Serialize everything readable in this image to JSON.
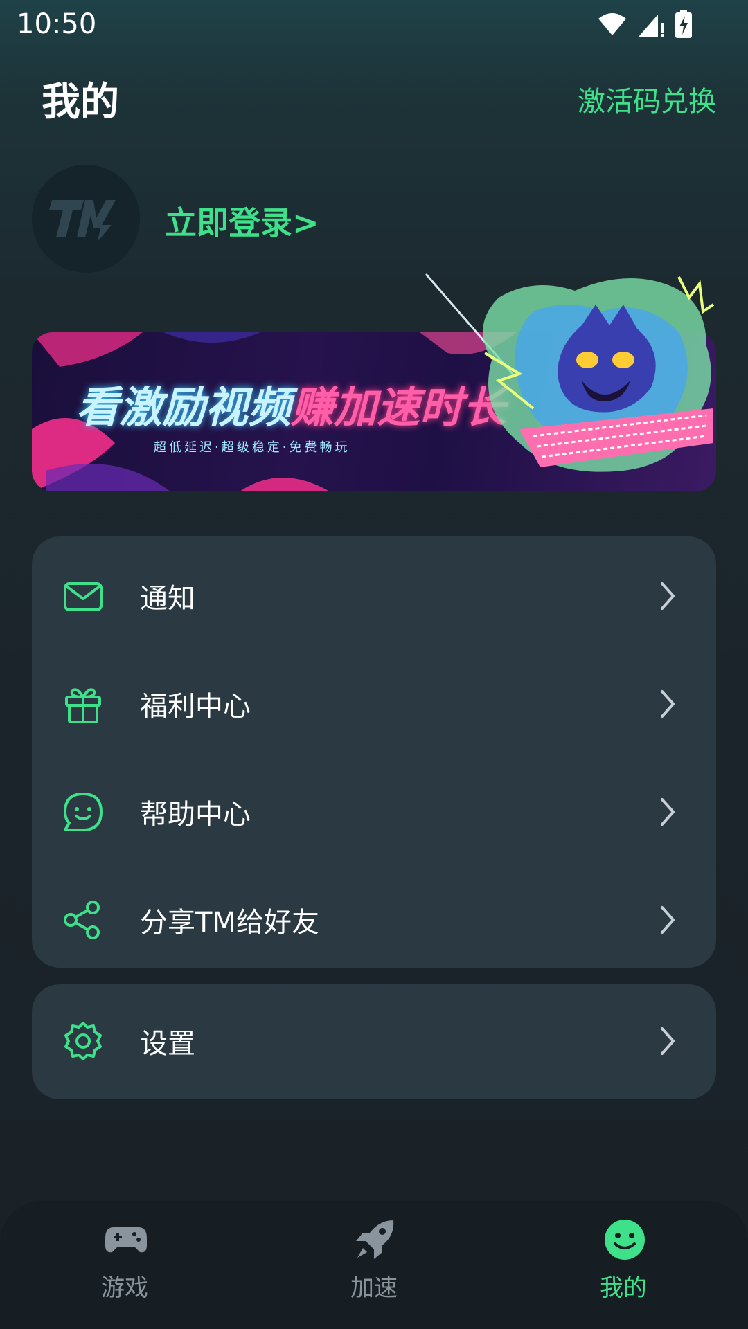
{
  "status_bar": {
    "time": "10:50"
  },
  "header": {
    "title": "我的",
    "redeem_label": "激活码兑换"
  },
  "profile": {
    "avatar_text": "TM",
    "login_label": "立即登录>"
  },
  "banner": {
    "title_part1": "看激励视频",
    "title_part2": "赚加速时长",
    "subtitle": "超低延迟·超级稳定·免费畅玩"
  },
  "menu": {
    "items": [
      {
        "label": "通知",
        "icon": "mail-icon"
      },
      {
        "label": "福利中心",
        "icon": "gift-icon"
      },
      {
        "label": "帮助中心",
        "icon": "chat-smile-icon"
      },
      {
        "label": "分享TM给好友",
        "icon": "share-icon"
      }
    ],
    "settings": {
      "label": "设置",
      "icon": "gear-icon"
    }
  },
  "tabs": [
    {
      "label": "游戏",
      "icon": "gamepad-icon",
      "active": false
    },
    {
      "label": "加速",
      "icon": "rocket-icon",
      "active": false
    },
    {
      "label": "我的",
      "icon": "smiley-icon",
      "active": true
    }
  ],
  "colors": {
    "accent": "#3ee08a",
    "card": "#2b3943",
    "tab_bar": "#161d23",
    "inactive": "#8a949c"
  }
}
